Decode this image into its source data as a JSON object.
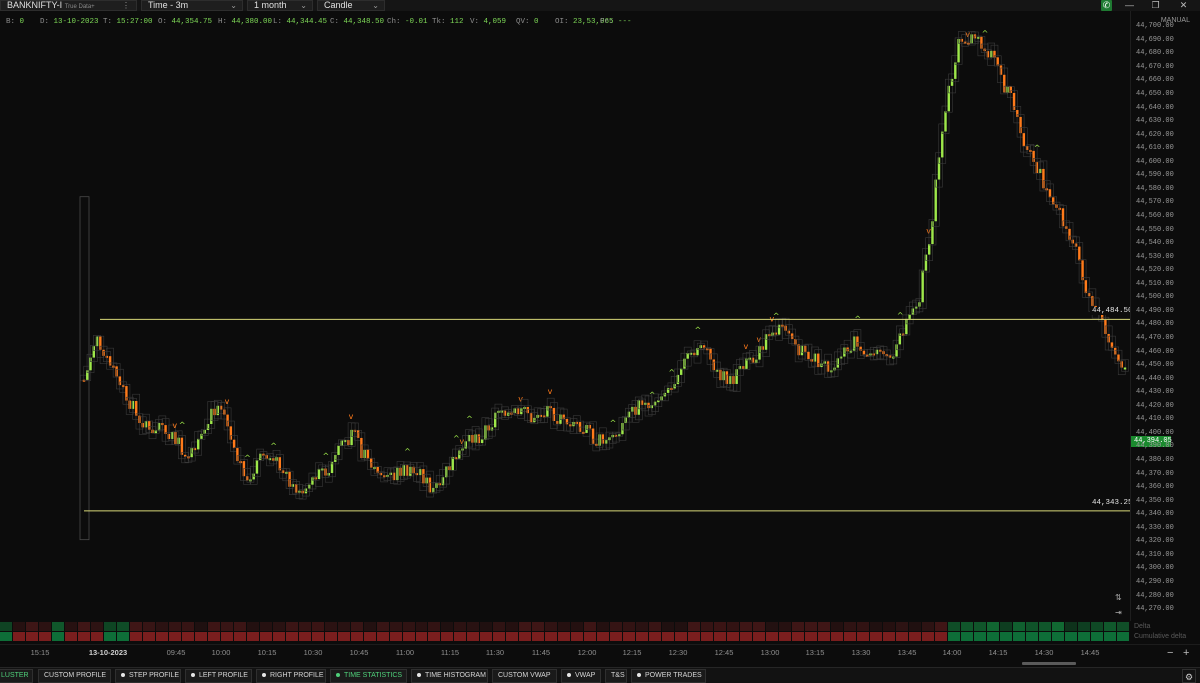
{
  "toolbar": {
    "symbol": "BANKNIFTY-I",
    "symbol_source": "True Data+",
    "timeframe": "Time - 3m",
    "range": "1 month",
    "chart_style": "Candle"
  },
  "infoline": [
    {
      "k": "B:",
      "v": "0"
    },
    {
      "k": "D:",
      "v": "13-10-2023"
    },
    {
      "k": "T:",
      "v": "15:27:00"
    },
    {
      "k": "O:",
      "v": "44,354.75"
    },
    {
      "k": "H:",
      "v": "44,380.00"
    },
    {
      "k": "L:",
      "v": "44,344.45"
    },
    {
      "k": "C:",
      "v": "44,348.50"
    },
    {
      "k": "Ch:",
      "v": "-0.01"
    },
    {
      "k": "Tk:",
      "v": "112"
    },
    {
      "k": "V:",
      "v": "4,059"
    },
    {
      "k": "QV:",
      "v": "0"
    },
    {
      "k": "OI:",
      "v": "23,53,065"
    },
    {
      "k": "Fr:",
      "v": "---"
    }
  ],
  "price_axis": {
    "mode": "MANUAL",
    "labels": [
      "44,700.00",
      "44,690.00",
      "44,680.00",
      "44,670.00",
      "44,660.00",
      "44,650.00",
      "44,640.00",
      "44,630.00",
      "44,620.00",
      "44,610.00",
      "44,600.00",
      "44,590.00",
      "44,580.00",
      "44,570.00",
      "44,560.00",
      "44,550.00",
      "44,540.00",
      "44,530.00",
      "44,520.00",
      "44,510.00",
      "44,500.00",
      "44,490.00",
      "44,480.00",
      "44,470.00",
      "44,460.00",
      "44,450.00",
      "44,440.00",
      "44,430.00",
      "44,420.00",
      "44,410.00",
      "44,400.00",
      "44,390.00",
      "44,380.00",
      "44,370.00",
      "44,360.00",
      "44,350.00",
      "44,340.00",
      "44,330.00",
      "44,320.00",
      "44,310.00",
      "44,300.00",
      "44,290.00",
      "44,280.00",
      "44,270.00"
    ],
    "last_price": "44,394.05",
    "last_price_value": 44394.05
  },
  "levels": [
    {
      "label": "44,484.50",
      "value": 44484.5
    },
    {
      "label": "44,343.25",
      "value": 44343.25
    }
  ],
  "chart_data": {
    "type": "candlestick",
    "symbol": "BANKNIFTY-I",
    "interval": "3m",
    "date": "13-10-2023",
    "y_range": [
      44262,
      44712
    ],
    "x_labels": [
      "15:15",
      "13-10-2023",
      "09:45",
      "10:00",
      "10:15",
      "10:30",
      "10:45",
      "11:00",
      "11:15",
      "11:30",
      "11:45",
      "12:00",
      "12:15",
      "12:30",
      "12:45",
      "13:00",
      "13:15",
      "13:30",
      "13:45",
      "14:00",
      "14:15",
      "14:30",
      "14:45"
    ],
    "close_path": [
      44440,
      44470,
      44455,
      44435,
      44415,
      44402,
      44408,
      44398,
      44385,
      44400,
      44420,
      44410,
      44375,
      44370,
      44385,
      44380,
      44362,
      44355,
      44368,
      44372,
      44395,
      44398,
      44380,
      44372,
      44368,
      44375,
      44370,
      44360,
      44372,
      44385,
      44395,
      44398,
      44412,
      44420,
      44418,
      44410,
      44415,
      44410,
      44412,
      44402,
      44395,
      44392,
      44408,
      44420,
      44425,
      44428,
      44440,
      44458,
      44465,
      44450,
      44440,
      44445,
      44455,
      44468,
      44478,
      44470,
      44460,
      44455,
      44448,
      44462,
      44470,
      44460,
      44455,
      44462,
      44480,
      44500,
      44560,
      44640,
      44690,
      44695,
      44688,
      44670,
      44650,
      44620,
      44600,
      44580,
      44560,
      44540,
      44500,
      44490,
      44462,
      44448
    ],
    "delta": [
      1,
      -1,
      -1,
      -1,
      1,
      -1,
      -1,
      -1,
      1,
      1,
      -1,
      -1,
      -1,
      -1,
      -1,
      -1,
      -1,
      -1,
      -1,
      -1,
      -1,
      -1,
      -1,
      -1,
      -1,
      -1,
      -1,
      -1,
      -1,
      -1,
      -1,
      -1,
      -1,
      -1,
      -1,
      -1,
      -1,
      -1,
      -1,
      -1,
      -1,
      -1,
      -1,
      -1,
      -1,
      -1,
      -1,
      -1,
      -1,
      -1,
      -1,
      -1,
      -1,
      -1,
      -1,
      -1,
      -1,
      -1,
      -1,
      -1,
      -1,
      -1,
      -1,
      -1,
      -1,
      -1,
      -1,
      -1,
      -1,
      -1,
      -1,
      -1,
      -1,
      1,
      1,
      1,
      1,
      1,
      1,
      1,
      1,
      1,
      1,
      1,
      1,
      1,
      1
    ]
  },
  "delta_labels": {
    "delta": "Delta",
    "cumulative": "Cumulative delta"
  },
  "tabs": [
    {
      "label": "LUSTER",
      "dot": false,
      "active": true
    },
    {
      "label": "CUSTOM PROFILE",
      "dot": false,
      "active": false
    },
    {
      "label": "STEP PROFILE",
      "dot": true,
      "active": false
    },
    {
      "label": "LEFT PROFILE",
      "dot": true,
      "active": false
    },
    {
      "label": "RIGHT PROFILE",
      "dot": true,
      "active": false
    },
    {
      "label": "TIME STATISTICS",
      "dot": true,
      "active": true
    },
    {
      "label": "TIME HISTOGRAM",
      "dot": true,
      "active": false
    },
    {
      "label": "CUSTOM VWAP",
      "dot": false,
      "active": false
    },
    {
      "label": "VWAP",
      "dot": true,
      "active": false
    },
    {
      "label": "T&S",
      "dot": false,
      "active": false
    },
    {
      "label": "POWER TRADES",
      "dot": true,
      "active": false
    }
  ],
  "colors": {
    "up": "#9ee84a",
    "down": "#ff7a1a",
    "level": "#d8d878",
    "buy": "#0e6e38",
    "sell": "#7a1e1e",
    "accent": "#1a8a2e"
  }
}
